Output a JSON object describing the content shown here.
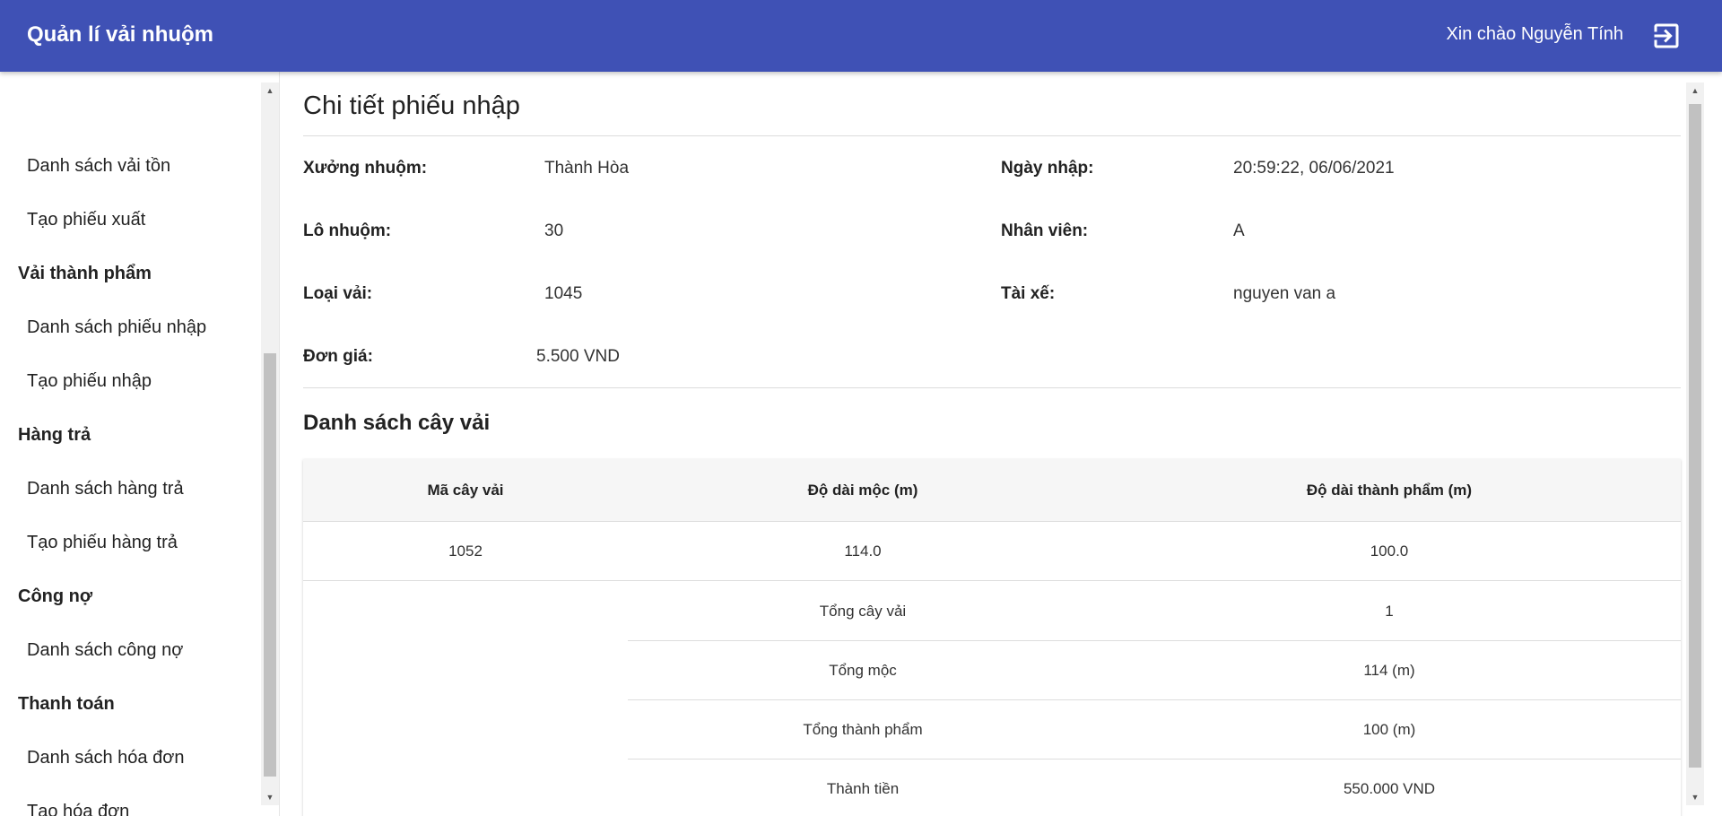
{
  "header": {
    "app_title": "Quản lí vải nhuộm",
    "greeting": "Xin chào Nguyễn Tính",
    "logout_icon": "logout-icon"
  },
  "sidebar": {
    "items": [
      {
        "type": "item",
        "label": "Danh sách vải tồn"
      },
      {
        "type": "item",
        "label": "Tạo phiếu xuất"
      },
      {
        "type": "group",
        "label": "Vải thành phẩm"
      },
      {
        "type": "item",
        "label": "Danh sách phiếu nhập"
      },
      {
        "type": "item",
        "label": "Tạo phiếu nhập"
      },
      {
        "type": "group",
        "label": "Hàng trả"
      },
      {
        "type": "item",
        "label": "Danh sách hàng trả"
      },
      {
        "type": "item",
        "label": "Tạo phiếu hàng trả"
      },
      {
        "type": "group",
        "label": "Công nợ"
      },
      {
        "type": "item",
        "label": "Danh sách công nợ"
      },
      {
        "type": "group",
        "label": "Thanh toán"
      },
      {
        "type": "item",
        "label": "Danh sách hóa đơn"
      },
      {
        "type": "item",
        "label": "Tạo hóa đơn"
      }
    ]
  },
  "main": {
    "page_title": "Chi tiết phiếu nhập",
    "fields": {
      "dye_house_label": "Xưởng nhuộm:",
      "dye_house_value": "Thành Hòa",
      "import_date_label": "Ngày nhập:",
      "import_date_value": "20:59:22, 06/06/2021",
      "dye_lot_label": "Lô nhuộm:",
      "dye_lot_value": "30",
      "staff_label": "Nhân viên:",
      "staff_value": "A",
      "fabric_type_label": "Loại vải:",
      "fabric_type_value": "1045",
      "driver_label": "Tài xế:",
      "driver_value": "nguyen van a",
      "unit_price_label": "Đơn giá:",
      "unit_price_value": "5.500 VND"
    },
    "section_title": "Danh sách cây vải",
    "table": {
      "headers": [
        "Mã cây vải",
        "Độ dài mộc (m)",
        "Độ dài thành phẩm (m)"
      ],
      "rows": [
        {
          "code": "1052",
          "raw_length": "114.0",
          "finished_length": "100.0"
        }
      ],
      "summary": [
        {
          "label": "Tổng cây vải",
          "value": "1"
        },
        {
          "label": "Tổng mộc",
          "value": "114 (m)"
        },
        {
          "label": "Tổng thành phẩm",
          "value": "100 (m)"
        },
        {
          "label": "Thành tiền",
          "value": "550.000 VND"
        }
      ]
    }
  },
  "colors": {
    "app_bar": "#3f51b5",
    "table_header_bg": "#f6f6f6"
  }
}
